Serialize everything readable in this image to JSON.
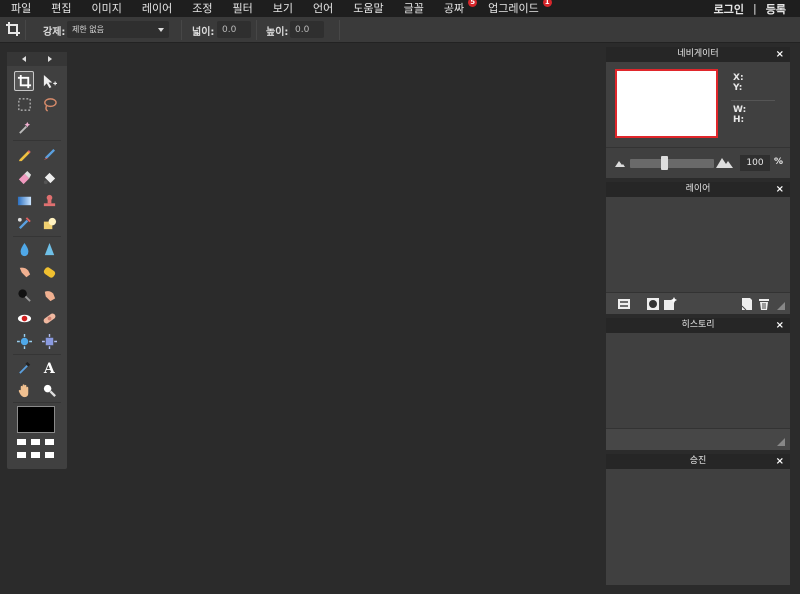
{
  "menu": {
    "items": [
      {
        "label": "파일"
      },
      {
        "label": "편집"
      },
      {
        "label": "이미지"
      },
      {
        "label": "레이어"
      },
      {
        "label": "조정"
      },
      {
        "label": "필터"
      },
      {
        "label": "보기"
      },
      {
        "label": "언어"
      },
      {
        "label": "도움말"
      },
      {
        "label": "글꼴"
      },
      {
        "label": "공짜",
        "badge": "5"
      },
      {
        "label": "업그레이드",
        "badge": "1"
      }
    ],
    "login": "로그인",
    "separator": "|",
    "register": "등록"
  },
  "options": {
    "constraint_label": "강제:",
    "constraint_value": "제한 없음",
    "width_label": "넓이:",
    "width_value": "0.0",
    "height_label": "높이:",
    "height_value": "0.0"
  },
  "tools": {
    "foreground_color": "#000000",
    "active_tool": "crop"
  },
  "navigator": {
    "title": "네비게이터",
    "close": "×",
    "x_label": "X:",
    "y_label": "Y:",
    "w_label": "W:",
    "h_label": "H:",
    "zoom_value": "100",
    "zoom_unit": "%",
    "zoom_slider_fraction": 0.5
  },
  "layers": {
    "title": "레이어",
    "close": "×"
  },
  "history": {
    "title": "히스토리",
    "close": "×"
  },
  "effects": {
    "title": "승진",
    "close": "×"
  },
  "colors": {
    "accent_red": "#e0262b",
    "badge_red": "#d6262b"
  }
}
